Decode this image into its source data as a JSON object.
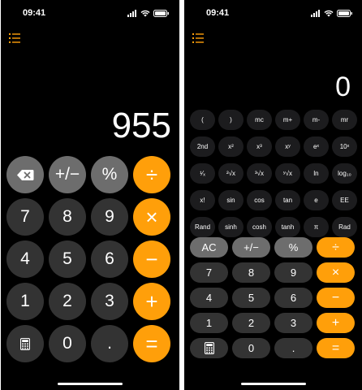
{
  "status_bar": {
    "time": "09:41"
  },
  "left": {
    "display_value": "955",
    "keys": [
      {
        "label": "",
        "icon": "backspace-icon",
        "style": "k-lgray"
      },
      {
        "label": "+/−",
        "style": "k-lgray"
      },
      {
        "label": "%",
        "style": "k-lgray"
      },
      {
        "label": "÷",
        "style": "k-orange"
      },
      {
        "label": "7",
        "style": "k-dark"
      },
      {
        "label": "8",
        "style": "k-dark"
      },
      {
        "label": "9",
        "style": "k-dark"
      },
      {
        "label": "×",
        "style": "k-orange"
      },
      {
        "label": "4",
        "style": "k-dark"
      },
      {
        "label": "5",
        "style": "k-dark"
      },
      {
        "label": "6",
        "style": "k-dark"
      },
      {
        "label": "−",
        "style": "k-orange"
      },
      {
        "label": "1",
        "style": "k-dark"
      },
      {
        "label": "2",
        "style": "k-dark"
      },
      {
        "label": "3",
        "style": "k-dark"
      },
      {
        "label": "+",
        "style": "k-orange"
      },
      {
        "label": "",
        "icon": "calculator-icon",
        "style": "k-dark"
      },
      {
        "label": "0",
        "style": "k-dark"
      },
      {
        "label": ".",
        "style": "k-dark"
      },
      {
        "label": "=",
        "style": "k-orange"
      }
    ]
  },
  "right": {
    "display_value": "0",
    "scientific_keys": [
      "(",
      ")",
      "mc",
      "m+",
      "m-",
      "mr",
      "2nd",
      "x²",
      "x³",
      "xʸ",
      "eˣ",
      "10ˣ",
      "¹⁄ₓ",
      "²√x",
      "³√x",
      "ʸ√x",
      "ln",
      "log₁₀",
      "x!",
      "sin",
      "cos",
      "tan",
      "e",
      "EE",
      "Rand",
      "sinh",
      "cosh",
      "tanh",
      "π",
      "Rad"
    ],
    "basic_keys": [
      {
        "label": "AC",
        "style": "k-lgray"
      },
      {
        "label": "+/−",
        "style": "k-lgray"
      },
      {
        "label": "%",
        "style": "k-lgray"
      },
      {
        "label": "÷",
        "style": "k-orange"
      },
      {
        "label": "7",
        "style": "k-dark"
      },
      {
        "label": "8",
        "style": "k-dark"
      },
      {
        "label": "9",
        "style": "k-dark"
      },
      {
        "label": "×",
        "style": "k-orange"
      },
      {
        "label": "4",
        "style": "k-dark"
      },
      {
        "label": "5",
        "style": "k-dark"
      },
      {
        "label": "6",
        "style": "k-dark"
      },
      {
        "label": "−",
        "style": "k-orange"
      },
      {
        "label": "1",
        "style": "k-dark"
      },
      {
        "label": "2",
        "style": "k-dark"
      },
      {
        "label": "3",
        "style": "k-dark"
      },
      {
        "label": "+",
        "style": "k-orange"
      },
      {
        "label": "",
        "icon": "calculator-icon",
        "style": "k-dark"
      },
      {
        "label": "0",
        "style": "k-dark"
      },
      {
        "label": ".",
        "style": "k-dark"
      },
      {
        "label": "=",
        "style": "k-orange"
      }
    ]
  },
  "colors": {
    "accent": "#ff9f0a",
    "key_dark": "#333333",
    "key_function": "#a5a5a5",
    "background": "#000000"
  }
}
